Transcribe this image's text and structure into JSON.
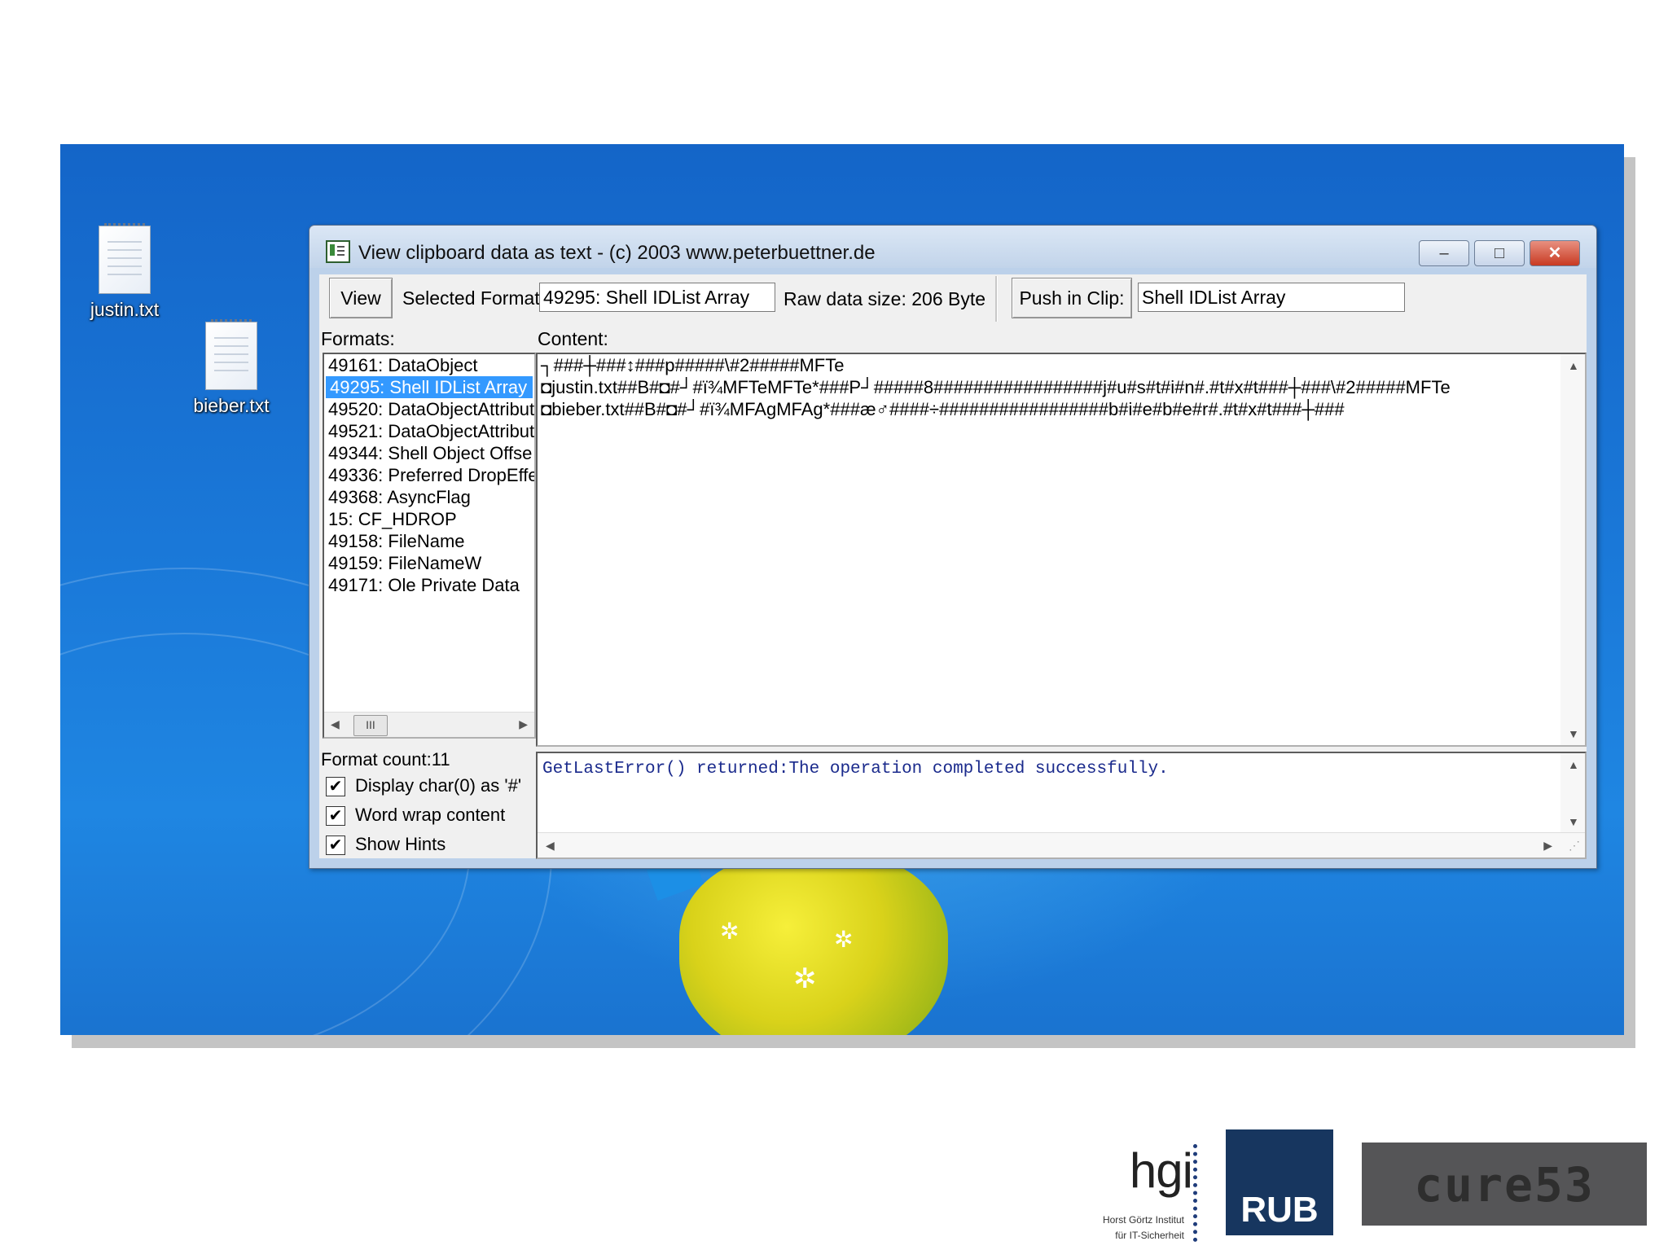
{
  "desktop": {
    "icons": [
      {
        "label": "justin.txt"
      },
      {
        "label": "bieber.txt"
      }
    ]
  },
  "window": {
    "title": "View clipboard data as text - (c) 2003 www.peterbuettner.de",
    "controls": {
      "minimize": "–",
      "maximize": "□",
      "close": "✕"
    }
  },
  "toolbar": {
    "view_label": "View",
    "selected_format_label": "Selected Format:",
    "selected_format_value": "49295: Shell IDList Array",
    "raw_size": "Raw data size: 206 Byte",
    "push_label": "Push in Clip:",
    "push_value": "Shell IDList Array"
  },
  "formats": {
    "label": "Formats:",
    "items": [
      "49161: DataObject",
      "49295: Shell IDList Array",
      "49520: DataObjectAttribut",
      "49521: DataObjectAttribut",
      "49344: Shell Object Offse",
      "49336: Preferred DropEffe",
      "49368: AsyncFlag",
      "15: CF_HDROP",
      "49158: FileName",
      "49159: FileNameW",
      "49171: Ole Private Data"
    ],
    "selected_index": 1,
    "count": "Format count:11"
  },
  "content": {
    "label": "Content:",
    "lines": [
      "┐###┼###↕###p#####\\#2#####MFTe",
      "◘justin.txt##B#◘#┘#ï¾MFTeMFTe*###P┘#####8#################j#u#s#t#i#n#.#t#x#t###┼###\\#2#####MFTe",
      "◘bieber.txt##B#◘#┘#ï¾MFAgMFAg*###æ♂####÷#################b#i#e#b#e#r#.#t#x#t###┼###"
    ]
  },
  "output": {
    "text": "GetLastError() returned:The operation completed successfully."
  },
  "options": [
    {
      "label": "Display char(0) as '#'",
      "checked": "✔"
    },
    {
      "label": "Word wrap content",
      "checked": "✔"
    },
    {
      "label": "Show Hints",
      "checked": "✔"
    }
  ],
  "scroll": {
    "thumb_grip": "III"
  },
  "logos": {
    "hgi": {
      "mark": "hgi",
      "line1": "Horst Görtz Institut",
      "line2": "für IT-Sicherheit"
    },
    "rub": "RUB",
    "cure": "cure53"
  }
}
